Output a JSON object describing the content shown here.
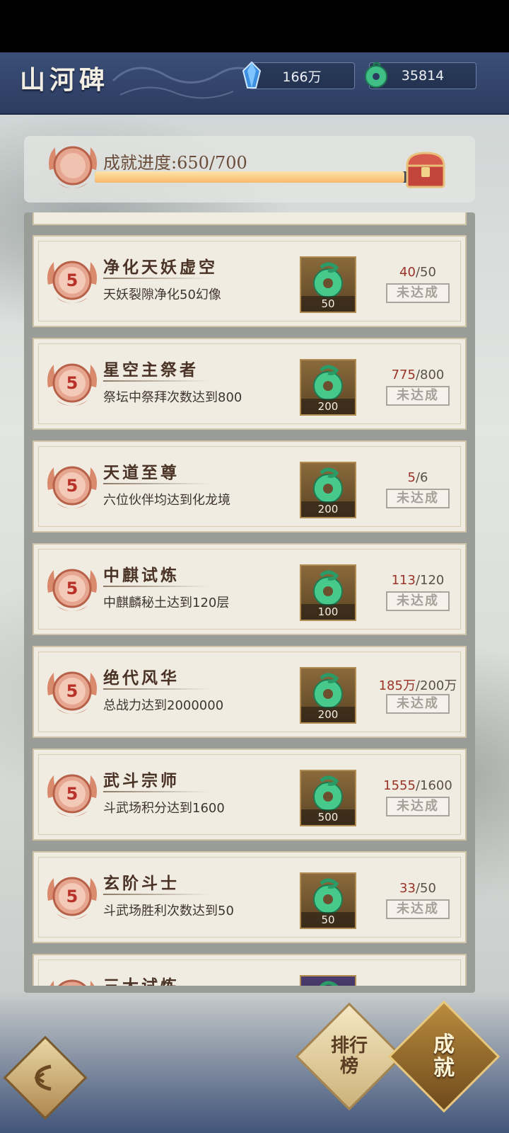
{
  "header": {
    "title": "山河碑",
    "crystal_amount": "166万",
    "jade_amount": "35814"
  },
  "progress": {
    "label": "成就进度:650/700",
    "current": 650,
    "total": 700,
    "fraction": 0.9286
  },
  "achievements": [
    {
      "level": "5",
      "name": "净化天妖虚空",
      "desc": "天妖裂隙净化50幻像",
      "reward": "50",
      "current": "40",
      "total": "50",
      "status": "未达成"
    },
    {
      "level": "5",
      "name": "星空主祭者",
      "desc": "祭坛中祭拜次数达到800",
      "reward": "200",
      "current": "775",
      "total": "800",
      "status": "未达成"
    },
    {
      "level": "5",
      "name": "天道至尊",
      "desc": "六位伙伴均达到化龙境",
      "reward": "200",
      "current": "5",
      "total": "6",
      "status": "未达成"
    },
    {
      "level": "5",
      "name": "中麒试炼",
      "desc": "中麒麟秘土达到120层",
      "reward": "100",
      "current": "113",
      "total": "120",
      "status": "未达成"
    },
    {
      "level": "5",
      "name": "绝代风华",
      "desc": "总战力达到2000000",
      "reward": "200",
      "current": "185万",
      "total": "200万",
      "status": "未达成"
    },
    {
      "level": "5",
      "name": "武斗宗师",
      "desc": "斗武场积分达到1600",
      "reward": "500",
      "current": "1555",
      "total": "1600",
      "status": "未达成"
    },
    {
      "level": "5",
      "name": "玄阶斗士",
      "desc": "斗武场胜利次数达到50",
      "reward": "50",
      "current": "33",
      "total": "50",
      "status": "未达成"
    },
    {
      "level": "",
      "name": "三大试炼",
      "desc": "",
      "reward": "",
      "current": "",
      "total": "",
      "status": ""
    }
  ],
  "nav": {
    "rank_label": "排行榜",
    "achievement_label": "成就"
  },
  "icons": {
    "crystal": "blue-crystal-icon",
    "jade": "jade-pendant-icon",
    "chest": "treasure-chest-icon",
    "medal": "level-medal-icon",
    "back": "back-icon"
  }
}
